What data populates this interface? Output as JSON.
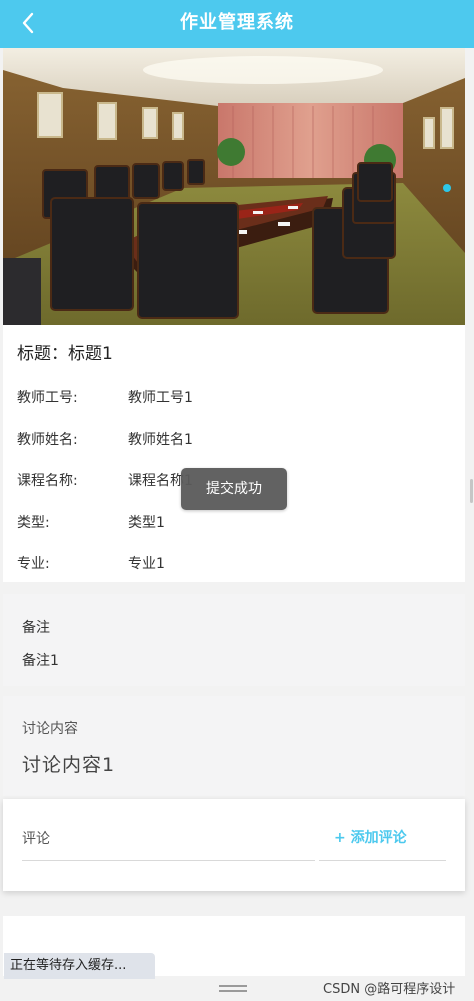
{
  "header": {
    "title": "作业管理系统",
    "back_icon": "chevron-left-icon"
  },
  "banner": {
    "image": "conference-room-photo"
  },
  "detail": {
    "heading_label": "标题：",
    "heading_value": "标题1",
    "fields": [
      {
        "label": "教师工号:",
        "value": "教师工号1"
      },
      {
        "label": "教师姓名:",
        "value": "教师姓名1"
      },
      {
        "label": "课程名称:",
        "value": "课程名称1"
      },
      {
        "label": "类型:",
        "value": "类型1"
      },
      {
        "label": "专业:",
        "value": "专业1"
      }
    ]
  },
  "toast": {
    "text": "提交成功"
  },
  "remark": {
    "label": "备注",
    "value": "备注1"
  },
  "discussion": {
    "label": "讨论内容",
    "value": "讨论内容1"
  },
  "comment": {
    "label": "评论",
    "add_label": "+ 添加评论"
  },
  "status": {
    "text": "正在等待存入缓存..."
  },
  "watermark": {
    "text": "CSDN @路可程序设计"
  },
  "colors": {
    "header_bg": "#4dc9ee",
    "accent": "#4dc9ee",
    "toast_bg": "#5a5a5a"
  }
}
